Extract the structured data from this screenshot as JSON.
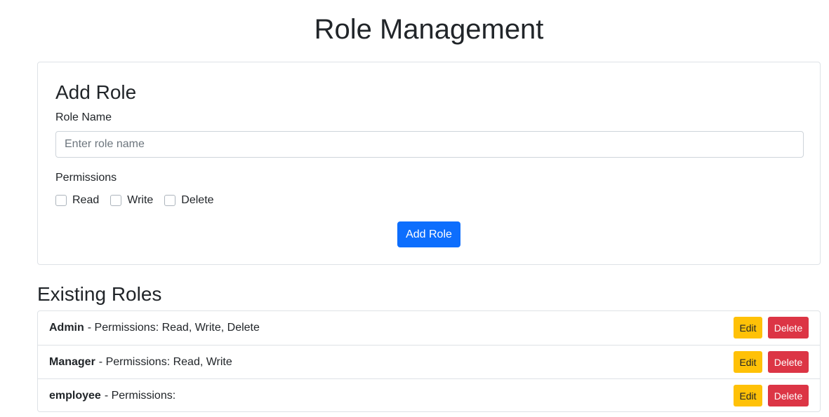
{
  "page": {
    "title": "Role Management"
  },
  "add_role": {
    "title": "Add Role",
    "role_name_label": "Role Name",
    "role_name_placeholder": "Enter role name",
    "role_name_value": "",
    "permissions_label": "Permissions",
    "permissions": [
      {
        "label": "Read",
        "checked": false
      },
      {
        "label": "Write",
        "checked": false
      },
      {
        "label": "Delete",
        "checked": false
      }
    ],
    "submit_label": "Add Role"
  },
  "existing_roles": {
    "title": "Existing Roles",
    "edit_label": "Edit",
    "delete_label": "Delete",
    "roles": [
      {
        "name": "Admin",
        "permissions_text": "- Permissions: Read, Write, Delete"
      },
      {
        "name": "Manager",
        "permissions_text": "- Permissions: Read, Write"
      },
      {
        "name": "employee",
        "permissions_text": "- Permissions:"
      }
    ]
  },
  "colors": {
    "primary": "#0d6efd",
    "warning": "#ffc107",
    "danger": "#dc3545",
    "border": "#dee2e6",
    "text": "#212529"
  }
}
